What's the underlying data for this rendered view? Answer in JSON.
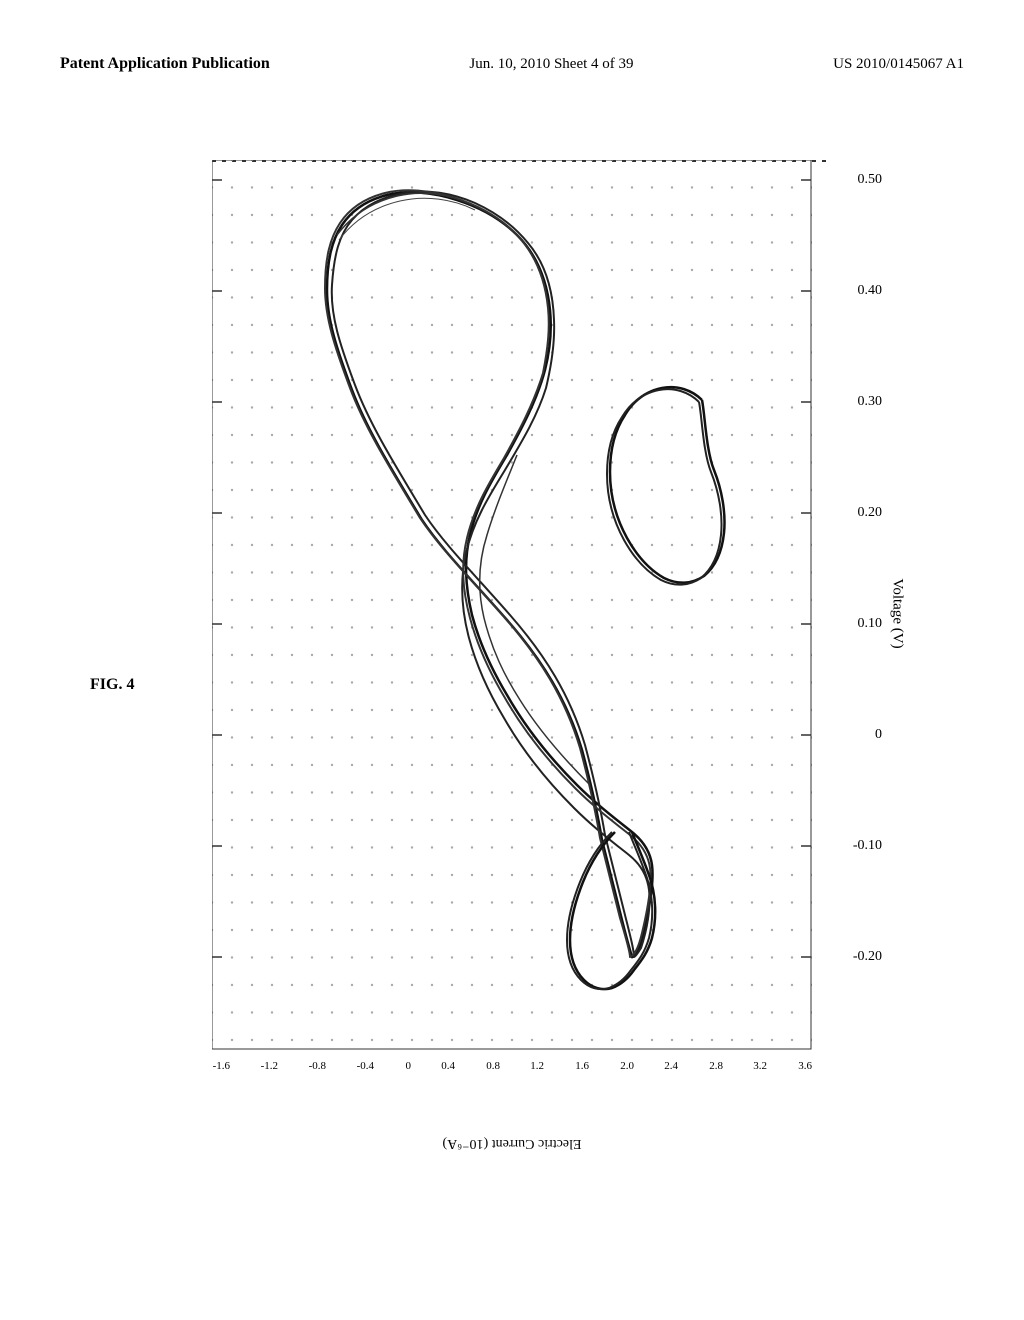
{
  "header": {
    "left": "Patent Application Publication",
    "center": "Jun. 10, 2010  Sheet 4 of 39",
    "right": "US 2010/0145067 A1"
  },
  "figure": {
    "label": "FIG. 4",
    "xaxis": {
      "label": "Electric Current  (10⁻⁶A)",
      "ticks": [
        "3.6",
        "3.2",
        "2.8",
        "2.4",
        "2.0",
        "1.6",
        "1.2",
        "0.8",
        "0.4",
        "0",
        "0.4",
        "0.8",
        "1.2",
        "1.6"
      ],
      "tick_signs": [
        "+",
        "+",
        "+",
        "+",
        "+",
        "+",
        "+",
        "+",
        "+",
        "0",
        "-",
        "-",
        "-",
        "-"
      ]
    },
    "yaxis": {
      "label": "Voltage  (V)",
      "ticks": [
        "-0.20",
        "-0.10",
        "0",
        "0.10",
        "0.20",
        "0.30",
        "0.40",
        "0.50"
      ]
    }
  }
}
